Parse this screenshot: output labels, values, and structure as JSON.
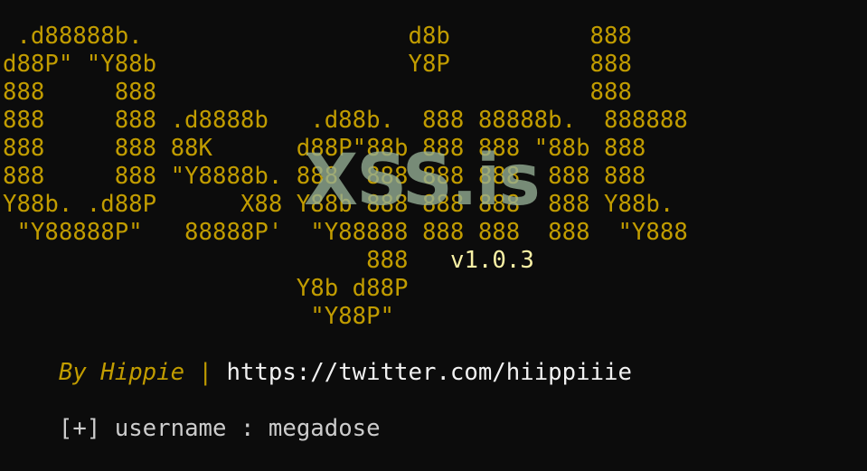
{
  "banner": {
    "lines": [
      " .d88888b.                   d8b          888",
      "d88P\" \"Y88b                  Y8P          888",
      "888     888                               888",
      "888     888 .d8888b   .d88b.  888 88888b.  888888",
      "888     888 88K      d88P\"88b 888 888 \"88b 888",
      "888     888 \"Y8888b. 888  888 888 888  888 888",
      "Y88b. .d88P      X88 Y88b 888 888 888  888 Y88b.",
      " \"Y88888P\"   88888P'  \"Y88888 888 888  888  \"Y888",
      "                          888",
      "                     Y8b d88P",
      "                      \"Y88P\""
    ],
    "version": "v1.0.3"
  },
  "watermark": "XSS.is",
  "credits": {
    "by_label": "By Hippie",
    "separator": "|",
    "url": "https://twitter.com/hiippiiie"
  },
  "status": {
    "prefix": "[+]",
    "label": "username",
    "separator": ":",
    "value": "megadose"
  },
  "colors": {
    "background": "#0c0c0c",
    "banner": "#c19c00",
    "text": "#cccccc",
    "url": "#f2f2f2",
    "version": "#f9f1a5"
  }
}
